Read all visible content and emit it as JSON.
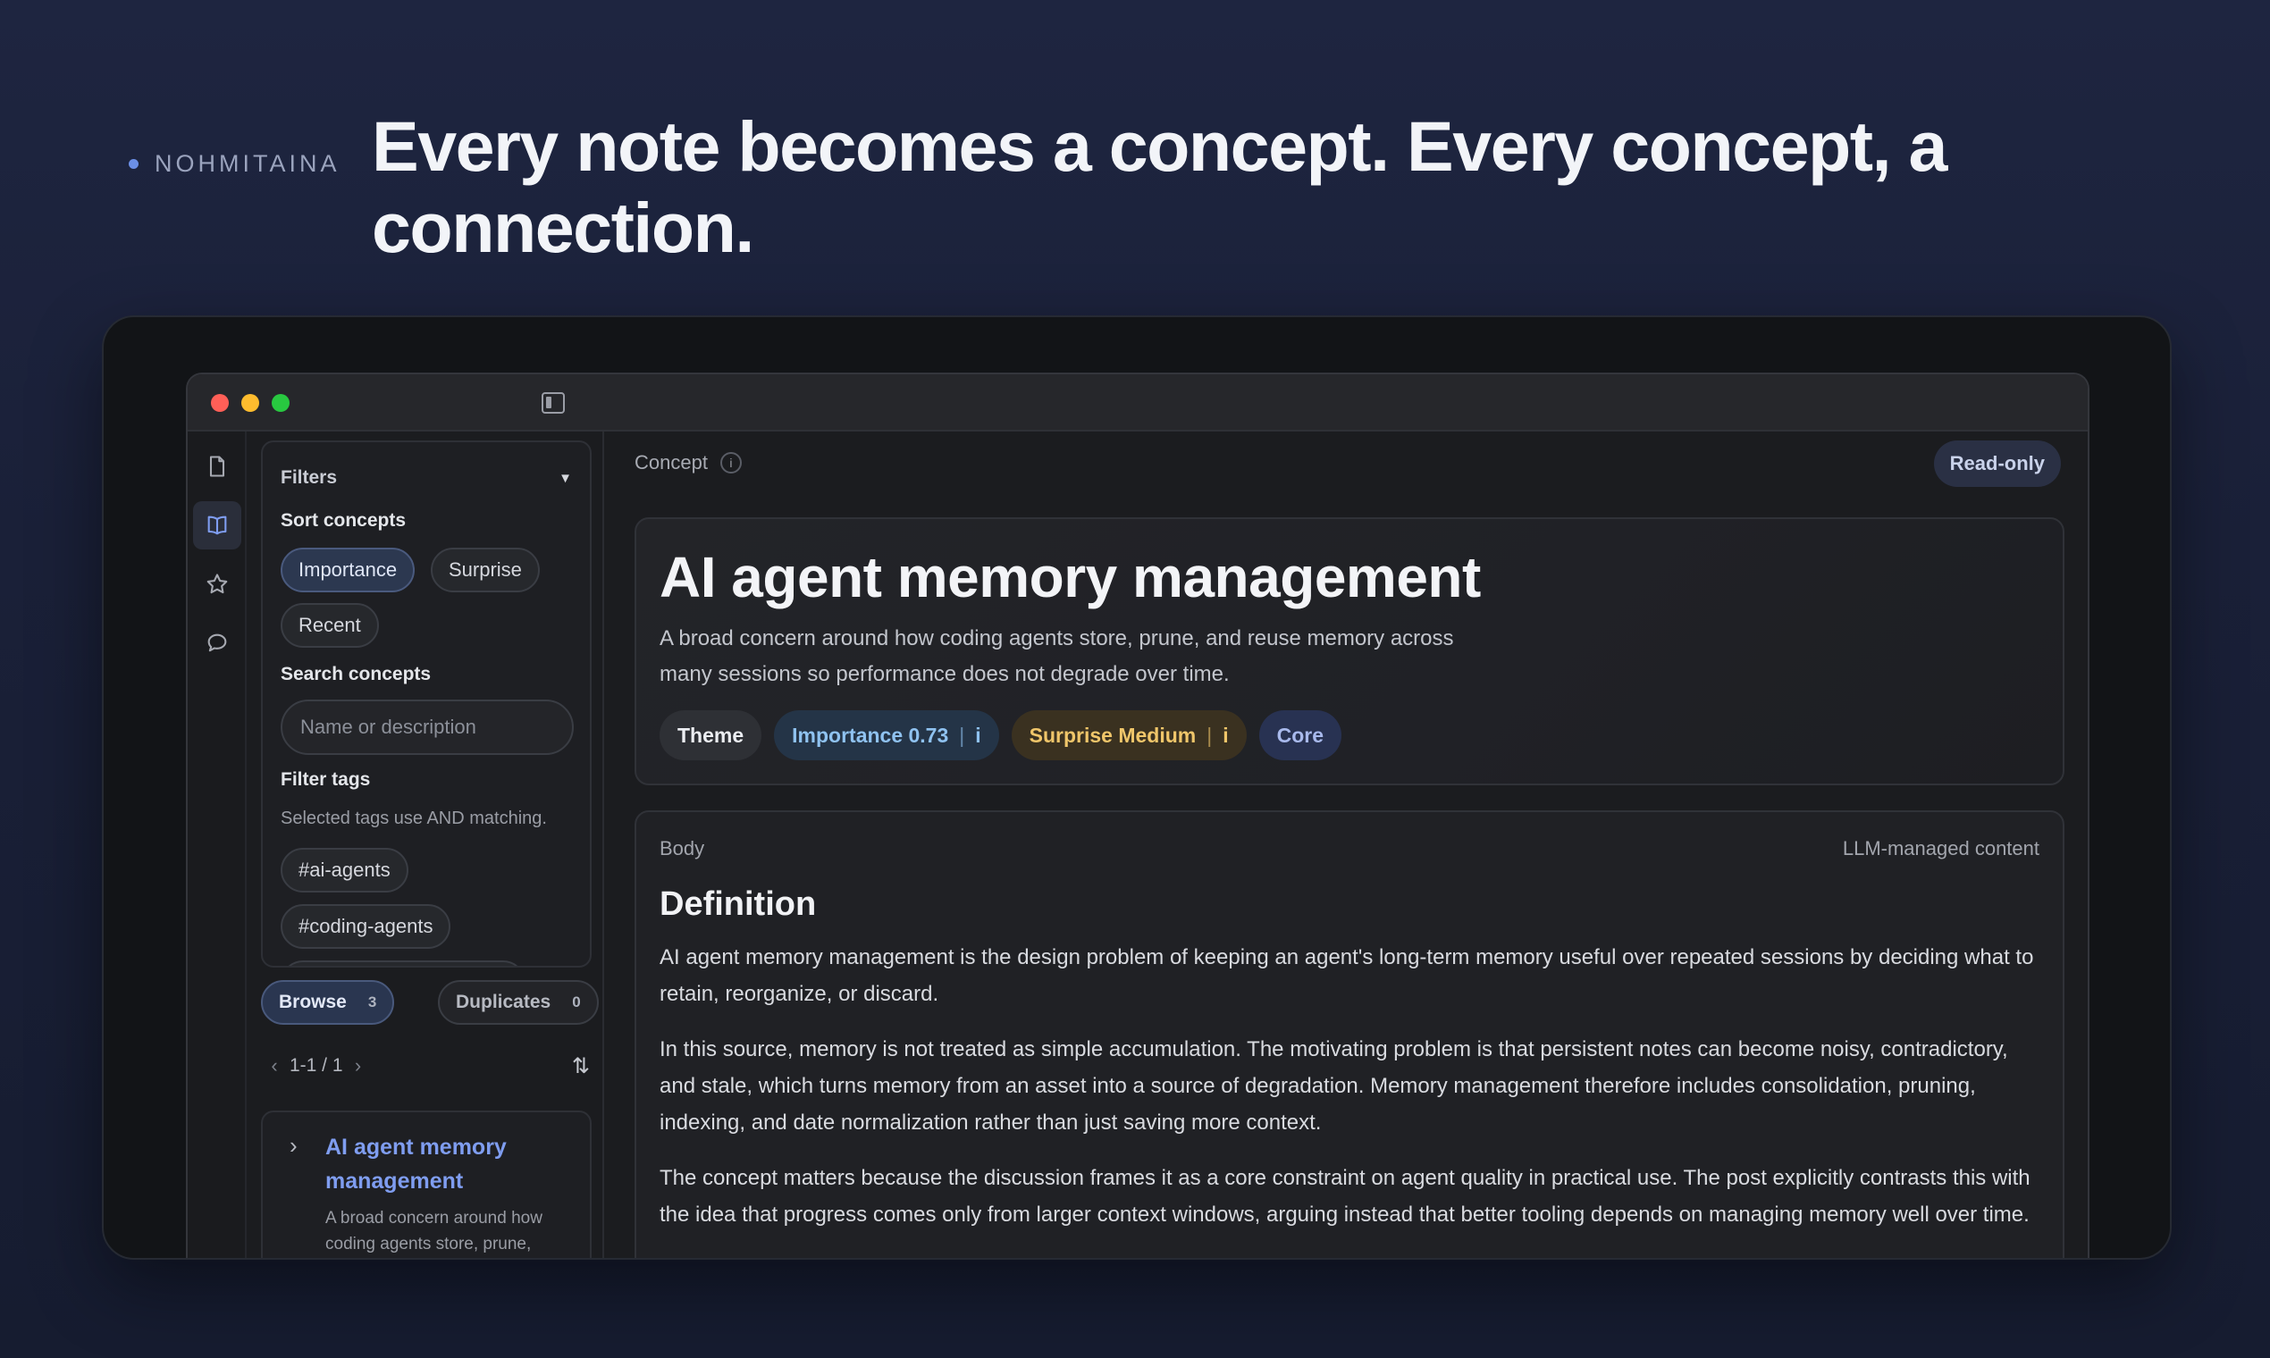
{
  "hero": {
    "brand": "NOHMITAINA",
    "headline": "Every note becomes a concept. Every concept, a connection."
  },
  "filters": {
    "title": "Filters",
    "sort_label": "Sort concepts",
    "sort_options": [
      "Importance",
      "Surprise",
      "Recent"
    ],
    "sort_selected": "Importance",
    "search_label": "Search concepts",
    "search_placeholder": "Name or description",
    "tags_label": "Filter tags",
    "tags_hint": "Selected tags use AND matching.",
    "tags": [
      "#ai-agents",
      "#coding-agents"
    ]
  },
  "list_tabs": [
    {
      "label": "Browse",
      "count": "3"
    },
    {
      "label": "Duplicates",
      "count": "0"
    }
  ],
  "pager": {
    "range": "1-1 / 1"
  },
  "result": {
    "title": "AI agent memory management",
    "description": "A broad concern around how coding agents store, prune,"
  },
  "main": {
    "crumb": "Concept",
    "info_glyph": "i",
    "readonly_label": "Read-only",
    "title": "AI agent memory management",
    "description": "A broad concern around how coding agents store, prune, and reuse memory across many sessions so performance does not degrade over time.",
    "badges": {
      "theme": "Theme",
      "importance": "Importance 0.73",
      "surprise": "Surprise Medium",
      "info": "i",
      "core": "Core"
    },
    "body": {
      "label": "Body",
      "managed": "LLM-managed content",
      "heading": "Definition",
      "paragraphs": [
        "AI agent memory management is the design problem of keeping an agent's long-term memory useful over repeated sessions by deciding what to retain, reorganize, or discard.",
        "In this source, memory is not treated as simple accumulation. The motivating problem is that persistent notes can become noisy, contradictory, and stale, which turns memory from an asset into a source of degradation. Memory management therefore includes consolidation, pruning, indexing, and date normalization rather than just saving more context.",
        "The concept matters because the discussion frames it as a core constraint on agent quality in practical use. The post explicitly contrasts this with the idea that progress comes only from larger context windows, arguing instead that better tooling depends on managing memory well over time."
      ]
    }
  },
  "colors": {
    "accent": "#7f9df0",
    "importance": "#8fc2f0",
    "surprise": "#f0c66a"
  }
}
